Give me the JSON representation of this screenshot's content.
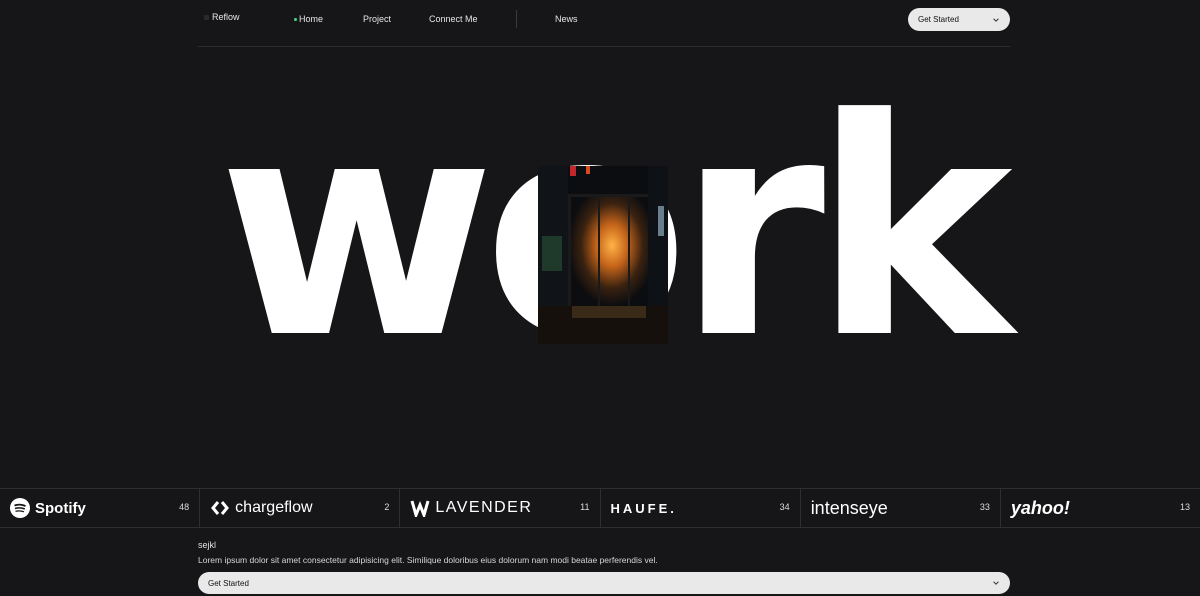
{
  "nav": {
    "brand": "Reflow",
    "links": [
      "Home",
      "Project",
      "Connect Me",
      "News"
    ],
    "cta": "Get Started"
  },
  "hero": {
    "word": "work"
  },
  "brands": [
    {
      "name": "Spotify",
      "count": "48"
    },
    {
      "name": "chargeflow",
      "count": "2"
    },
    {
      "name": "LAVENDER",
      "count": "11"
    },
    {
      "name": "HAUFE.",
      "count": "34"
    },
    {
      "name": "intenseye",
      "count": "33"
    },
    {
      "name": "yahoo!",
      "count": "13"
    }
  ],
  "footer": {
    "title": "sejkl",
    "text": "Lorem ipsum dolor sit amet consectetur adipisicing elit. Similique doloribus eius dolorum nam modi beatae perferendis vel.",
    "cta": "Get Started"
  }
}
